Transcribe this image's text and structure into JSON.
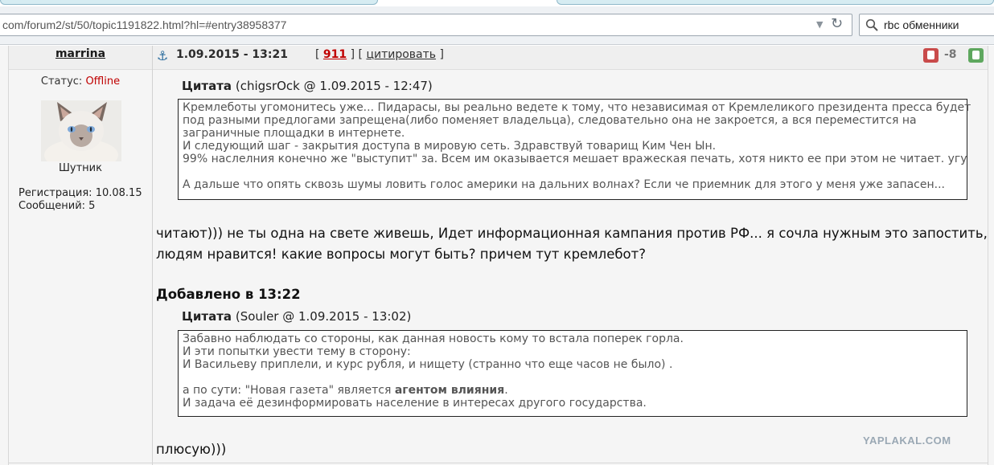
{
  "browser": {
    "url": "com/forum2/st/50/topic1191822.html?hl=#entry38958377",
    "search_query": "rbc обменники"
  },
  "author": {
    "name": "marrina",
    "status_label": "Статус:",
    "status_value": "Offline",
    "title": "Шутник",
    "registration_label": "Регистрация:",
    "registration_value": "10.08.15",
    "posts_label": "Сообщений:",
    "posts_value": "5"
  },
  "post": {
    "date": "1.09.2015 - 13:21",
    "number": "911",
    "quote_action": "цитировать",
    "rating": "-8",
    "quote1": {
      "label": "Цитата",
      "meta": "(chigsrOck @ 1.09.2015 - 12:47)",
      "lines": [
        "Кремлеботы угомонитесь уже... Пидарасы, вы реально ведете к тому, что независимая от Кремлеликого президента пресса будет",
        "под разными предлогами запрещена(либо поменяет владельца), следовательно она не закроется, а вся переместится на",
        "заграничные площадки в интернете.",
        "И следующий шаг - закрытия доступа в мировую сеть. Здравствуй товарищ Ким Чен Ын.",
        "99% наслелния конечно же \"выступит\" за. Всем им оказывается мешает вражеская печать, хотя никто ее при этом не читает. угу",
        "А дальше что опять сквозь шумы ловить голос америки на дальних волнах? Если че приемник для этого у меня уже запасен..."
      ]
    },
    "reply1": [
      "читают))) не ты одна на свете живешь, Идет информационная кампания против РФ... я сочла нужным это запостить,",
      "людям нравится! какие вопросы могут быть? причем тут кремлебот?"
    ],
    "added_label": "Добавлено в 13:22",
    "quote2": {
      "label": "Цитата",
      "meta": "(Souler @ 1.09.2015 - 13:02)",
      "lines": [
        "Забавно наблюдать со стороны, как данная новость кому то встала поперек горла.",
        "И эти попытки увести тему в сторону:",
        "И Васильеву приплели, и курс рубля, и нищету (странно что еще часов не было) ."
      ],
      "line_pre": "а по сути: \"Новая газета\" является ",
      "line_bold": "агентом влияния",
      "line_post": ".",
      "last_line": "И задача её дезинформировать население в интересах другого государства."
    },
    "reply2": "плюсую)))"
  },
  "watermark": "YAPLAKAL.COM",
  "colors": {
    "offline": "#c00000",
    "post_number": "#c00000",
    "vote_down": "#c94b4b",
    "vote_up": "#5ea75e"
  }
}
